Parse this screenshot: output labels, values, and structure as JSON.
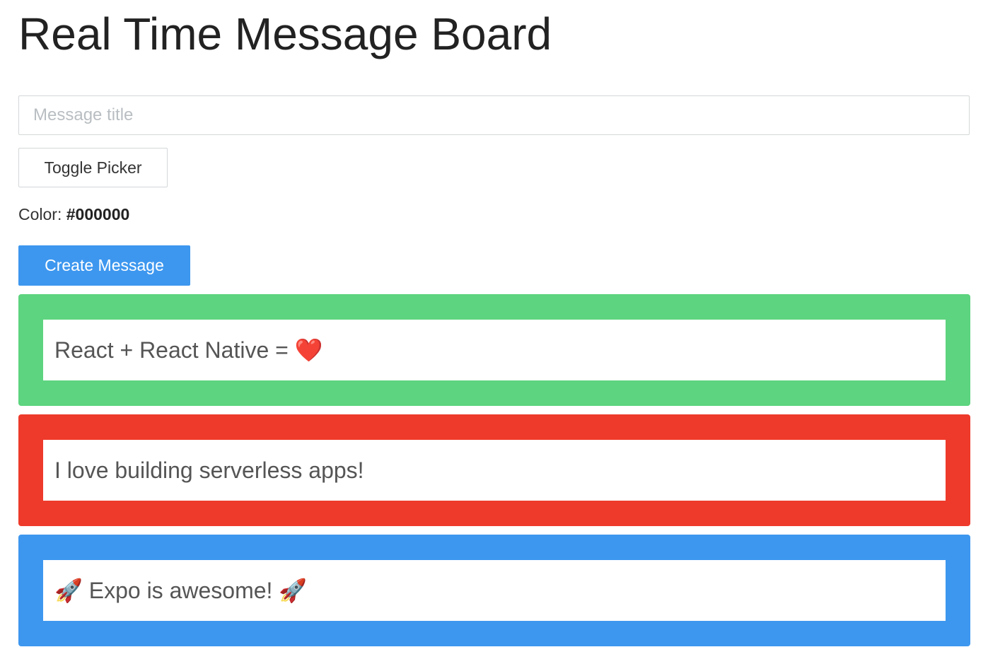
{
  "header": {
    "title": "Real Time Message Board"
  },
  "form": {
    "title_input": {
      "placeholder": "Message title",
      "value": ""
    },
    "toggle_picker_label": "Toggle Picker",
    "color_label": "Color:",
    "color_value": "#000000",
    "create_label": "Create Message",
    "create_color": "#3d97ef"
  },
  "messages": [
    {
      "text": "React + React Native = ❤️",
      "color": "#5dd47f"
    },
    {
      "text": "I love building serverless apps!",
      "color": "#ee3a2b"
    },
    {
      "text": "🚀 Expo is awesome! 🚀",
      "color": "#3d97ef"
    }
  ]
}
